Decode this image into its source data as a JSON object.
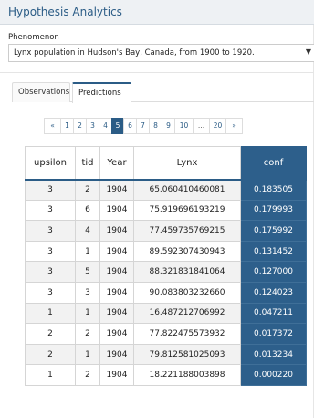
{
  "panel": {
    "title": "Hypothesis Analytics"
  },
  "phenomenon": {
    "label": "Phenomenon",
    "selected": "Lynx population in Hudson's Bay, Canada, from 1900 to 1920.",
    "arrow_icon": "caret-down-icon"
  },
  "tabs": [
    {
      "label": "Observations",
      "active": false
    },
    {
      "label": "Predictions",
      "active": true
    }
  ],
  "pagination": {
    "items": [
      "«",
      "1",
      "2",
      "3",
      "4",
      "5",
      "6",
      "7",
      "8",
      "9",
      "10",
      "...",
      "20",
      "»"
    ],
    "active": "5"
  },
  "table": {
    "headers": [
      "upsilon",
      "tid",
      "Year",
      "Lynx",
      "conf"
    ],
    "rows": [
      [
        "3",
        "2",
        "1904",
        "65.060410460081",
        "0.183505"
      ],
      [
        "3",
        "6",
        "1904",
        "75.919696193219",
        "0.179993"
      ],
      [
        "3",
        "4",
        "1904",
        "77.459735769215",
        "0.175992"
      ],
      [
        "3",
        "1",
        "1904",
        "89.592307430943",
        "0.131452"
      ],
      [
        "3",
        "5",
        "1904",
        "88.321831841064",
        "0.127000"
      ],
      [
        "3",
        "3",
        "1904",
        "90.083803232660",
        "0.124023"
      ],
      [
        "1",
        "1",
        "1904",
        "16.487212706992",
        "0.047211"
      ],
      [
        "2",
        "2",
        "1904",
        "77.822475573932",
        "0.017372"
      ],
      [
        "2",
        "1",
        "1904",
        "79.812581025093",
        "0.013234"
      ],
      [
        "1",
        "2",
        "1904",
        "18.221188003898",
        "0.000220"
      ]
    ]
  },
  "colors": {
    "accent": "#2d5f8b",
    "header_bg": "#eef1f4"
  }
}
